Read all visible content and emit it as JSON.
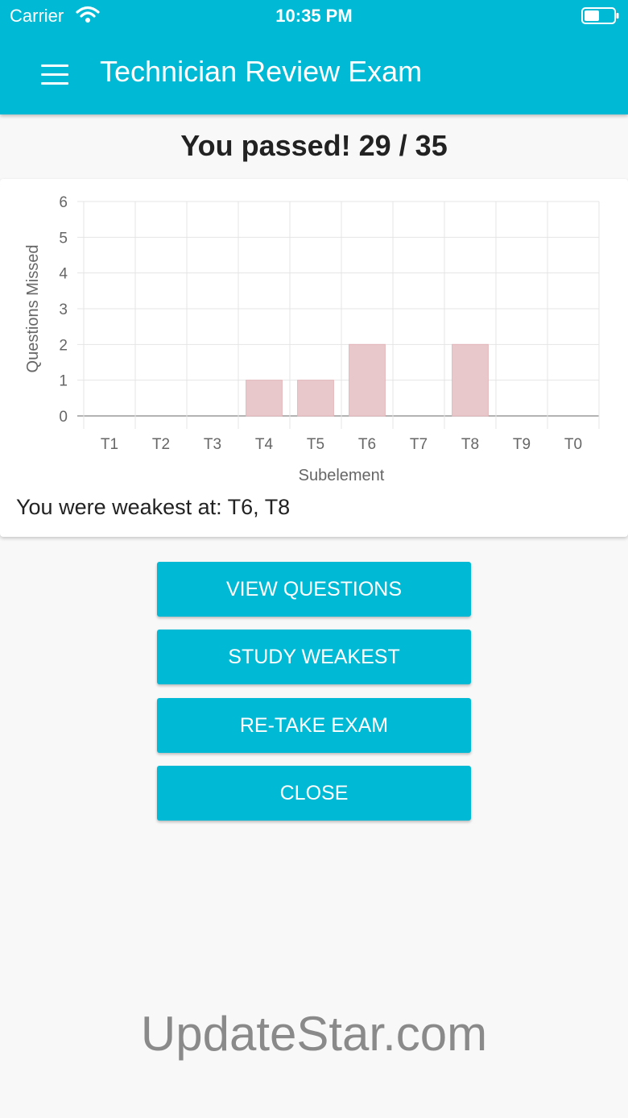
{
  "status_bar": {
    "carrier": "Carrier",
    "time": "10:35 PM"
  },
  "header": {
    "title": "Technician Review Exam",
    "menu_icon": "hamburger-menu-icon"
  },
  "result": {
    "title": "You passed! 29 / 35",
    "weakest_text": "You were weakest at: T6, T8"
  },
  "chart_data": {
    "type": "bar",
    "categories": [
      "T1",
      "T2",
      "T3",
      "T4",
      "T5",
      "T6",
      "T7",
      "T8",
      "T9",
      "T0"
    ],
    "values": [
      0,
      0,
      0,
      1,
      1,
      2,
      0,
      2,
      0,
      0
    ],
    "xlabel": "Subelement",
    "ylabel": "Questions Missed",
    "ylim": [
      0,
      6
    ],
    "yticks": [
      0,
      1,
      2,
      3,
      4,
      5,
      6
    ],
    "grid": true,
    "bar_color": "#e9c8cb",
    "bar_border_color": "#e3b6ba"
  },
  "buttons": {
    "view_questions": "VIEW QUESTIONS",
    "study_weakest": "STUDY WEAKEST",
    "retake_exam": "RE-TAKE EXAM",
    "close": "CLOSE"
  },
  "watermark": "UpdateStar.com",
  "colors": {
    "accent": "#00b9d4",
    "background": "#f8f8f8"
  }
}
